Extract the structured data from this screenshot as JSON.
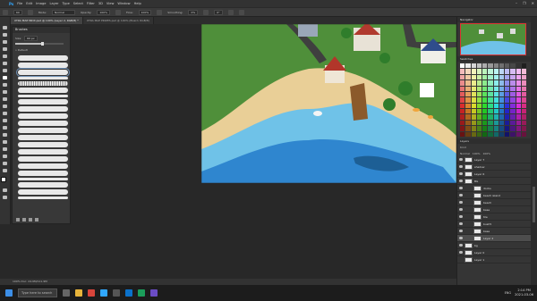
{
  "menu": [
    "File",
    "Edit",
    "Image",
    "Layer",
    "Type",
    "Select",
    "Filter",
    "3D",
    "View",
    "Window",
    "Help"
  ],
  "window_controls": [
    "–",
    "❐",
    "✕"
  ],
  "options_bar": {
    "size_field": "60",
    "mode_label": "Mode:",
    "mode_value": "Normal",
    "opacity_label": "Opacity:",
    "opacity_value": "100%",
    "flow_label": "Flow:",
    "flow_value": "100%",
    "smoothing_label": "Smoothing:",
    "smoothing_value": "0%",
    "angle_value": "0°"
  },
  "tabs": [
    {
      "label": "XTRA MAP INDX.psd @ 100% (Layer 2, RGB/8) *",
      "active": true
    },
    {
      "label": "XTRA MAP PRIZES.psd @ 100% (Board, RGB/8)",
      "active": false
    }
  ],
  "brushes_panel": {
    "title": "Brushes",
    "size_label": "Size:",
    "size_value": "60 px",
    "size_fraction": 0.55,
    "folder_label": "» Default"
  },
  "navigator_title": "Navigator",
  "swatches_title": "Swatches",
  "layers_panel": {
    "title": "Layers",
    "kind_label": "Kind",
    "blend_mode": "Normal",
    "opacity_value": "100%",
    "fill_value": "100%",
    "layers": [
      {
        "name": "Layer 7",
        "visible": true,
        "indent": false,
        "selected": false
      },
      {
        "name": "shadow",
        "visible": true,
        "indent": false,
        "selected": false
      },
      {
        "name": "Layer 6",
        "visible": true,
        "indent": false,
        "selected": false
      },
      {
        "name": "BG",
        "visible": true,
        "indent": false,
        "selected": false
      },
      {
        "name": "docks",
        "visible": true,
        "indent": true,
        "selected": false
      },
      {
        "name": "beach island",
        "visible": true,
        "indent": true,
        "selected": false
      },
      {
        "name": "beach",
        "visible": true,
        "indent": true,
        "selected": false
      },
      {
        "name": "base",
        "visible": true,
        "indent": true,
        "selected": false
      },
      {
        "name": "tile",
        "visible": true,
        "indent": true,
        "selected": false
      },
      {
        "name": "bush5",
        "visible": true,
        "indent": true,
        "selected": false
      },
      {
        "name": "base",
        "visible": true,
        "indent": true,
        "selected": false
      },
      {
        "name": "Layer 2",
        "visible": true,
        "indent": true,
        "selected": true
      },
      {
        "name": "bg",
        "visible": true,
        "indent": false,
        "selected": false
      },
      {
        "name": "Layer 0",
        "visible": true,
        "indent": false,
        "selected": false
      },
      {
        "name": "Layer 1",
        "visible": false,
        "indent": false,
        "selected": false
      }
    ]
  },
  "status_bar": "100%   Doc: 24.9M/111.9M",
  "taskbar": {
    "search_text": "Type here to search",
    "time": "2:14 PM",
    "date": "2021-03-06",
    "lang": "ENG"
  },
  "colors": {
    "grass": "#4f8f3a",
    "sand": "#e9cf97",
    "water_shallow": "#6fc2e8",
    "water_deep": "#2f86cf",
    "accent_selected": "#6d8fb5"
  }
}
